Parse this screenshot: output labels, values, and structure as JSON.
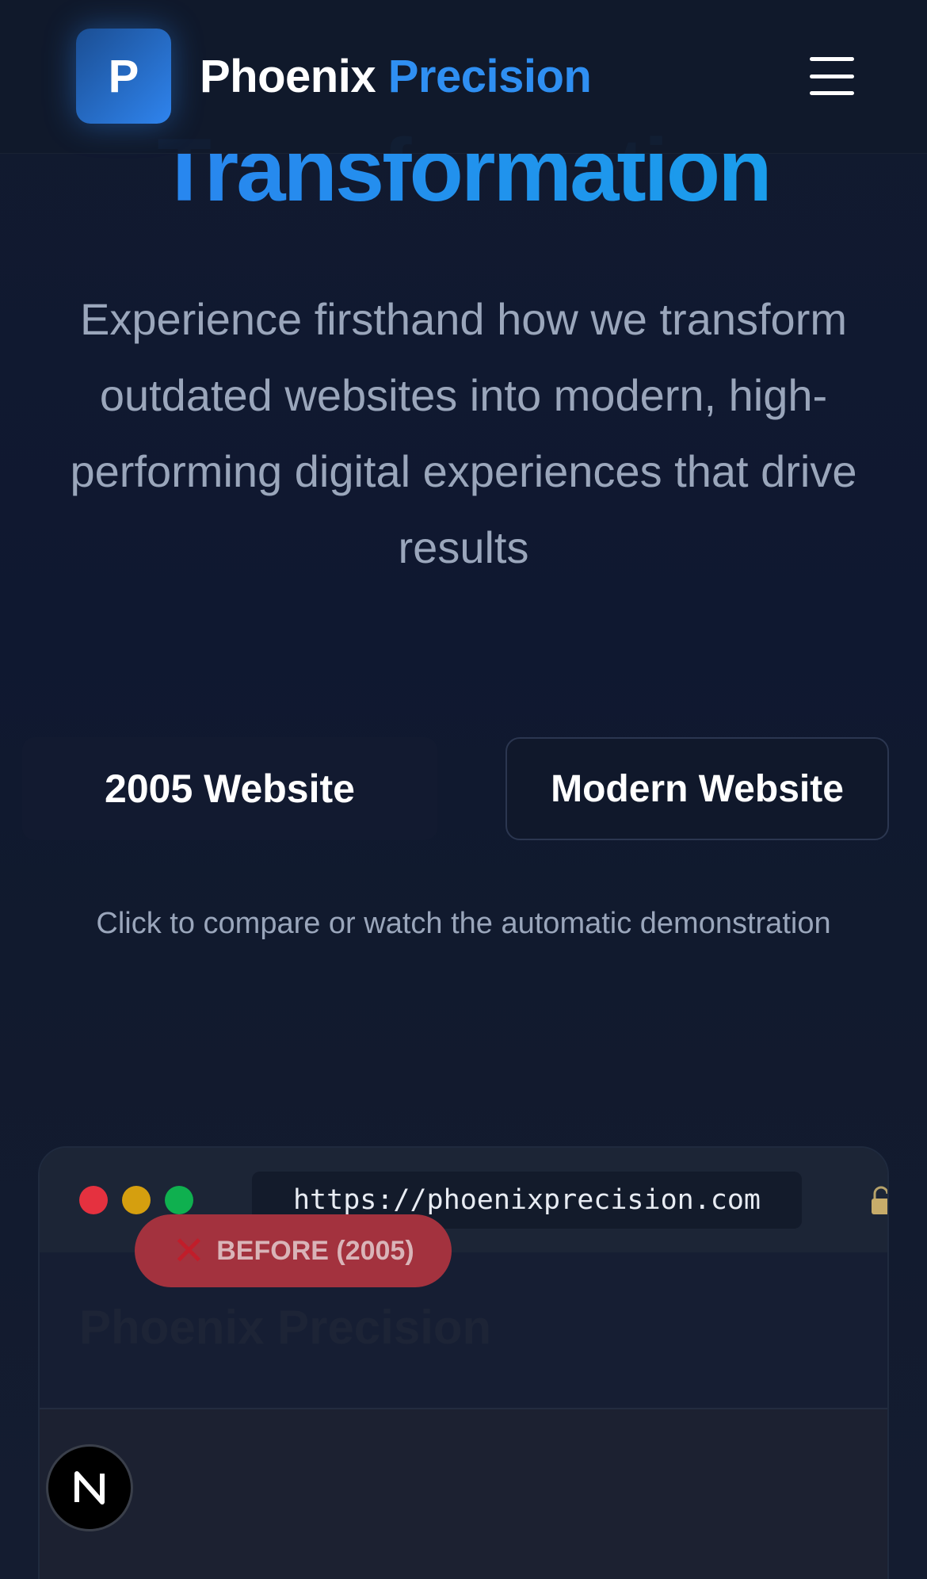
{
  "header": {
    "logo_letter": "P",
    "brand_primary": "Phoenix",
    "brand_accent": "Precision",
    "menu_icon": "hamburger-menu-icon"
  },
  "hero": {
    "title": "Transformation",
    "subtitle": "Experience firsthand how we transform outdated websites into modern, high-performing digital experiences that drive results"
  },
  "compare": {
    "old_label": "2005 Website",
    "new_label": "Modern Website",
    "hint": "Click to compare or watch the automatic demonstration"
  },
  "browser": {
    "url": "https://phoenixprecision.com",
    "badge_label": "BEFORE (2005)",
    "badge_icon": "x-mark-icon",
    "site_title": "Phoenix Precision"
  },
  "floating": {
    "dev_badge_letter": "N"
  },
  "colors": {
    "accent": "#2f8ff2",
    "background": "#111a2e",
    "muted_text": "#9aa6bb",
    "badge_red": "#a3323e"
  }
}
